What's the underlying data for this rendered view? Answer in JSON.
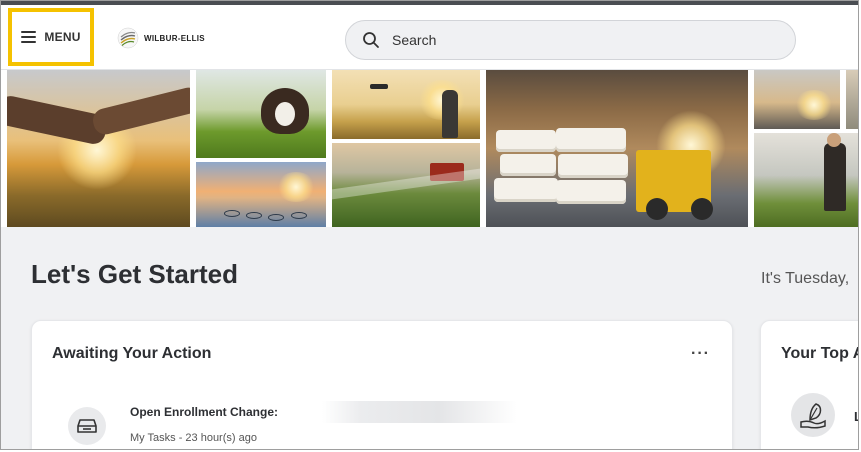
{
  "header": {
    "menu_label": "MENU",
    "logo_text": "WILBUR-ELLIS",
    "search_placeholder": "Search"
  },
  "main": {
    "greeting": "Let's Get Started",
    "date_text": "It's Tuesday, "
  },
  "awaiting_card": {
    "title": "Awaiting Your Action",
    "more_label": "···",
    "task": {
      "title": "Open Enrollment Change:",
      "subtitle": "My Tasks - 23 hour(s) ago"
    }
  },
  "top_apps_card": {
    "title": "Your Top A",
    "first_app_label": "L"
  },
  "colors": {
    "menu_highlight": "#f5c200",
    "background": "#f0f1f3",
    "card": "#ffffff"
  }
}
